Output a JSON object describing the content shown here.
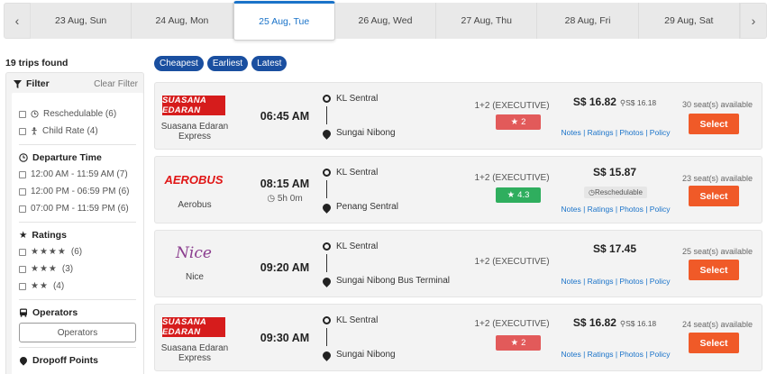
{
  "date_bar": {
    "prev": "‹",
    "next": "›",
    "dates": [
      "23 Aug, Sun",
      "24 Aug, Mon",
      "25 Aug, Tue",
      "26 Aug, Wed",
      "27 Aug, Thu",
      "28 Aug, Fri",
      "29 Aug, Sat"
    ],
    "active_index": 2
  },
  "sidebar": {
    "trips_found": "19 trips found",
    "filter_title": "Filter",
    "clear_filter": "Clear Filter",
    "options": {
      "reschedulable": "Reschedulable (6)",
      "child_rate": "Child Rate (4)"
    },
    "departure_time": {
      "title": "Departure Time",
      "items": [
        "12:00 AM - 11:59 AM (7)",
        "12:00 PM - 06:59 PM (6)",
        "07:00 PM - 11:59 PM (6)"
      ]
    },
    "ratings": {
      "title": "Ratings",
      "items": [
        {
          "stars": "★★★★",
          "count": "(6)"
        },
        {
          "stars": "★★★",
          "count": "(3)"
        },
        {
          "stars": "★★",
          "count": "(4)"
        }
      ]
    },
    "operators": {
      "title": "Operators",
      "button": "Operators"
    },
    "dropoff": {
      "title": "Dropoff Points"
    }
  },
  "sort_chips": [
    "Cheapest",
    "Earliest",
    "Latest"
  ],
  "icons": {
    "filter": "filter-icon",
    "clock": "clock-icon",
    "star": "star-icon",
    "bus": "bus-icon",
    "pin": "map-pin-icon",
    "child": "child-icon"
  },
  "colors": {
    "accent_blue": "#1a73c9",
    "chip_blue": "#1a4fa0",
    "select_orange": "#f05a28",
    "rating_red": "#e25a5a",
    "rating_green": "#2fae5e"
  },
  "trips": [
    {
      "logo_text": "SUASANA EDARAN",
      "operator": "Suasana Edaran Express",
      "operator_line1": "Suasana Edaran",
      "operator_line2": "Express",
      "time": "06:45 AM",
      "duration": "",
      "from": "KL Sentral",
      "to": "Sungai Nibong",
      "bus_type": "1+2 (EXECUTIVE)",
      "rating": "2",
      "price": "S$ 16.82",
      "child_price": "S$ 16.18",
      "reschedulable": "",
      "links": "Notes | Ratings | Photos | Policy",
      "seats": "30 seat(s) available",
      "select": "Select"
    },
    {
      "logo_text": "AEROBUS",
      "operator": "Aerobus",
      "time": "08:15 AM",
      "duration": "5h 0m",
      "from": "KL Sentral",
      "to": "Penang Sentral",
      "bus_type": "1+2 (EXECUTIVE)",
      "rating": "4.3",
      "price": "S$ 15.87",
      "child_price": "",
      "reschedulable": "Reschedulable",
      "links": "Notes | Ratings | Photos | Policy",
      "seats": "23 seat(s) available",
      "select": "Select"
    },
    {
      "logo_text": "Nice",
      "operator": "Nice",
      "time": "09:20 AM",
      "duration": "",
      "from": "KL Sentral",
      "to": "Sungai Nibong Bus Terminal",
      "bus_type": "1+2 (EXECUTIVE)",
      "rating": "",
      "price": "S$ 17.45",
      "child_price": "",
      "reschedulable": "",
      "links": "Notes | Ratings | Photos | Policy",
      "seats": "25 seat(s) available",
      "select": "Select"
    },
    {
      "logo_text": "SUASANA EDARAN",
      "operator": "Suasana Edaran Express",
      "operator_line1": "Suasana Edaran",
      "operator_line2": "Express",
      "time": "09:30 AM",
      "duration": "",
      "from": "KL Sentral",
      "to": "Sungai Nibong",
      "bus_type": "1+2 (EXECUTIVE)",
      "rating": "2",
      "price": "S$ 16.82",
      "child_price": "S$ 16.18",
      "reschedulable": "",
      "links": "Notes | Ratings | Photos | Policy",
      "seats": "24 seat(s) available",
      "select": "Select"
    }
  ]
}
